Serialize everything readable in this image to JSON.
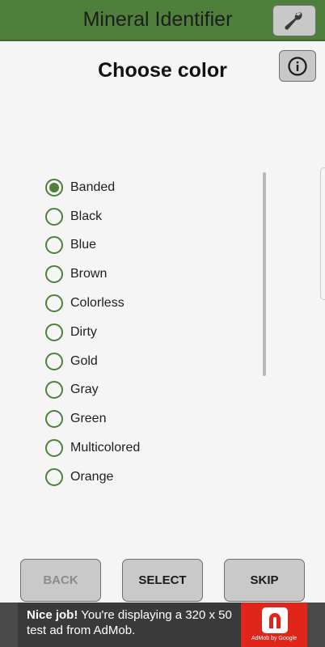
{
  "app": {
    "title": "Mineral Identifier",
    "tools_icon": "wrench-icon",
    "info_icon": "info-icon"
  },
  "page": {
    "title": "Choose color"
  },
  "options": [
    {
      "label": "Banded",
      "checked": true
    },
    {
      "label": "Black",
      "checked": false
    },
    {
      "label": "Blue",
      "checked": false
    },
    {
      "label": "Brown",
      "checked": false
    },
    {
      "label": "Colorless",
      "checked": false
    },
    {
      "label": "Dirty",
      "checked": false
    },
    {
      "label": "Gold",
      "checked": false
    },
    {
      "label": "Gray",
      "checked": false
    },
    {
      "label": "Green",
      "checked": false
    },
    {
      "label": "Multicolored",
      "checked": false
    },
    {
      "label": "Orange",
      "checked": false
    }
  ],
  "buttons": {
    "back": "BACK",
    "select": "SELECT",
    "skip": "SKIP"
  },
  "ad": {
    "bold": "Nice job!",
    "text": " You're displaying a 320 x 50 test ad from AdMob.",
    "logo_text": "AdMob by Google"
  },
  "colors": {
    "accent": "#4e7f3b",
    "ad_logo": "#e0251b"
  }
}
